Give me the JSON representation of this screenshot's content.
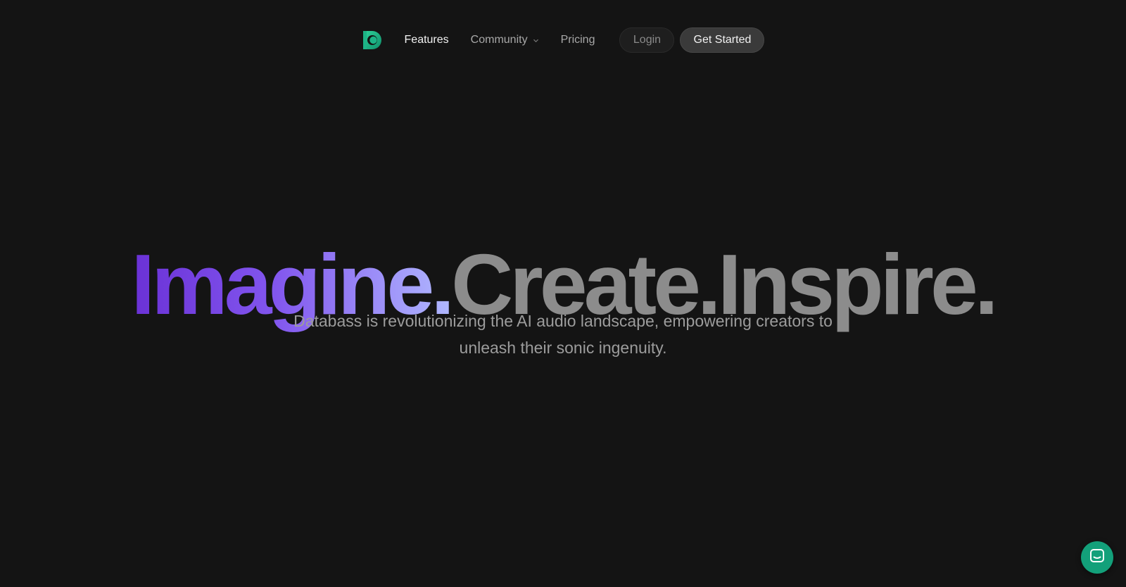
{
  "nav": {
    "logo_icon": "databass-logo-icon",
    "features_label": "Features",
    "community_label": "Community",
    "pricing_label": "Pricing",
    "login_label": "Login",
    "get_started_label": "Get Started"
  },
  "hero": {
    "word_imagine": "Imagine.",
    "word_create": "Create.",
    "word_inspire": "Inspire.",
    "subtitle": "Databass is revolutionizing the AI audio landscape, empowering creators to unleash their sonic ingenuity."
  },
  "chat_widget": {
    "icon": "chat-bubble-icon"
  },
  "colors": {
    "background": "#141414",
    "brand_green": "#13a07a",
    "gradient_start": "#6a31d6",
    "gradient_end": "#b0b8ff",
    "muted_text": "#8c8c8c"
  }
}
